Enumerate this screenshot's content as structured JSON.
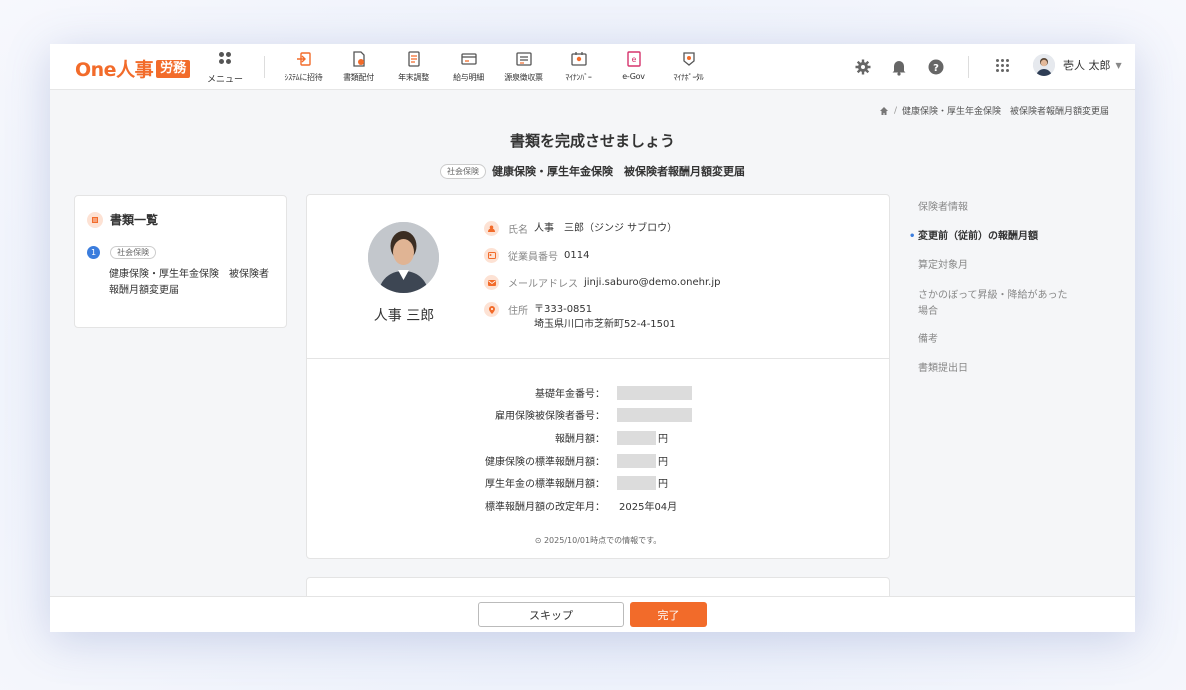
{
  "header": {
    "logo_text": "One人事",
    "logo_badge": "労務",
    "menu_label": "メニュー",
    "nav": [
      {
        "label": "ｼｽﾃﾑに招待",
        "icon": "invite-icon"
      },
      {
        "label": "書類配付",
        "icon": "document-distribute-icon"
      },
      {
        "label": "年末調整",
        "icon": "year-end-icon"
      },
      {
        "label": "給与明細",
        "icon": "payslip-icon"
      },
      {
        "label": "源泉徴収票",
        "icon": "withholding-icon"
      },
      {
        "label": "ﾏｲﾅﾝﾊﾞｰ",
        "icon": "mynumber-icon"
      },
      {
        "label": "e-Gov",
        "icon": "egov-icon"
      },
      {
        "label": "ﾏｲﾅﾎﾟｰﾀﾙ",
        "icon": "mynaportal-icon"
      }
    ],
    "user_name": "壱人 太郎"
  },
  "breadcrumb": {
    "item": "健康保険・厚生年金保険　被保険者報酬月額変更届"
  },
  "page": {
    "title": "書類を完成させましょう",
    "tag": "社会保険",
    "subtitle": "健康保険・厚生年金保険　被保険者報酬月額変更届"
  },
  "doc_list": {
    "title": "書類一覧",
    "items": [
      {
        "number": "1",
        "tag": "社会保険",
        "name": "健康保険・厚生年金保険　被保険者報酬月額変更届"
      }
    ]
  },
  "employee": {
    "display_name": "人事 三郎",
    "name_label": "氏名",
    "name_value": "人事　三郎（ジンジ サブロウ）",
    "number_label": "従業員番号",
    "number_value": "0114",
    "email_label": "メールアドレス",
    "email_value": "jinji.saburo@demo.onehr.jp",
    "address_label": "住所",
    "address_zip": "〒333-0851",
    "address_line": "埼玉県川口市芝新町52-4-1501"
  },
  "fields": {
    "pension_number_label": "基礎年金番号：",
    "employment_insurance_label": "雇用保険被保険者番号：",
    "monthly_pay_label": "報酬月額：",
    "health_standard_label": "健康保険の標準報酬月額：",
    "pension_standard_label": "厚生年金の標準報酬月額：",
    "revision_label": "標準報酬月額の改定年月：",
    "revision_value": "2025年04月",
    "unit_yen": "円",
    "note": "2025/10/01時点での情報です。"
  },
  "toc": [
    {
      "label": "保険者情報",
      "active": false
    },
    {
      "label": "変更前（従前）の報酬月額",
      "active": true
    },
    {
      "label": "算定対象月",
      "active": false
    },
    {
      "label": "さかのぼって昇級・降給があった場合",
      "active": false
    },
    {
      "label": "備考",
      "active": false
    },
    {
      "label": "書類提出日",
      "active": false
    }
  ],
  "footer": {
    "skip_label": "スキップ",
    "done_label": "完了"
  },
  "colors": {
    "accent": "#f26b2a",
    "link_blue": "#3b7ddd"
  }
}
